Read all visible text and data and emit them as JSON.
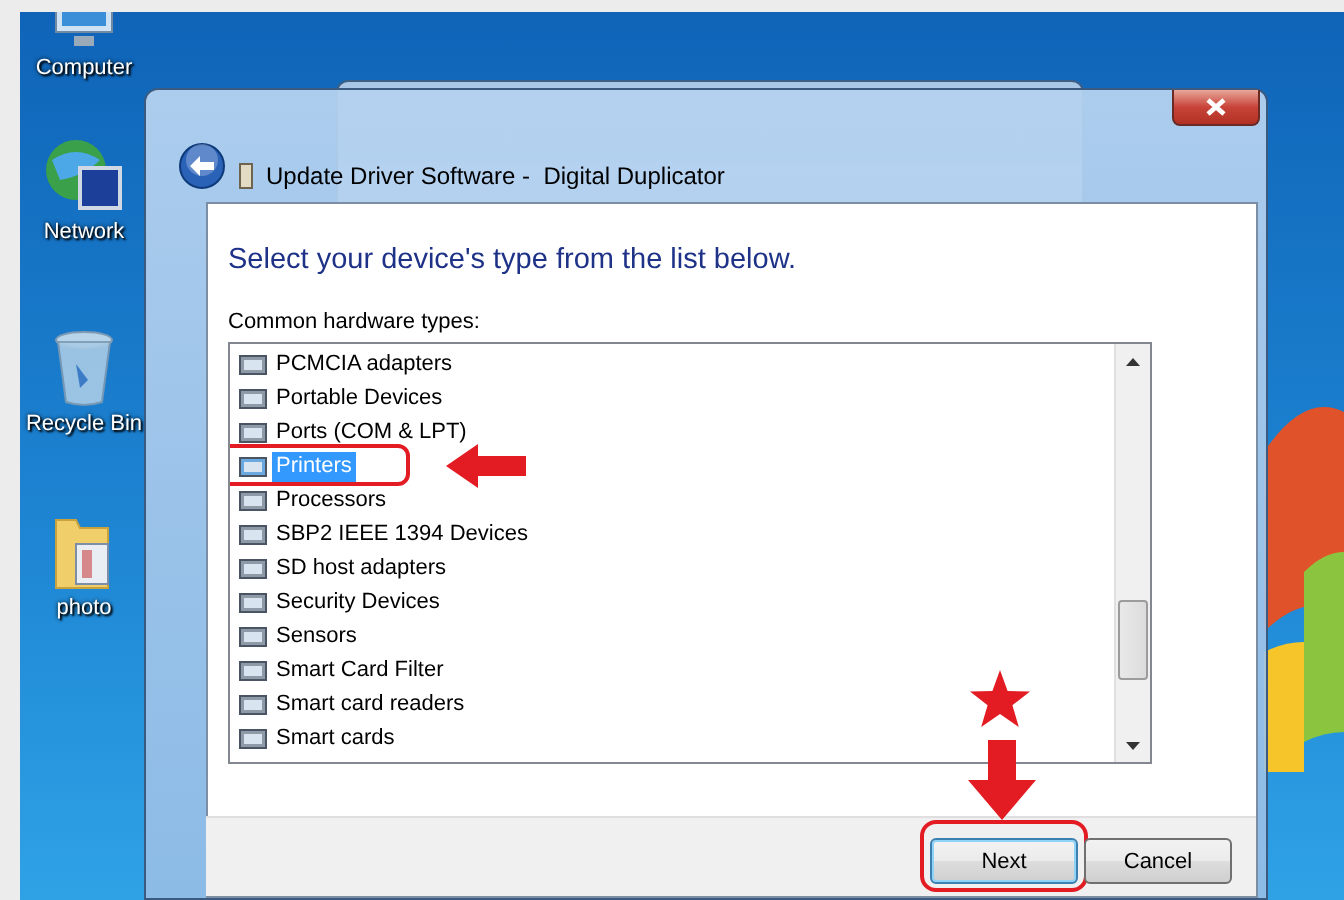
{
  "desktop_icons": [
    {
      "label": "Computer"
    },
    {
      "label": "Network"
    },
    {
      "label": "Recycle Bin"
    },
    {
      "label": "photo"
    }
  ],
  "dialog": {
    "title": "Update Driver Software -  Digital Duplicator",
    "heading": "Select your device's type from the list below.",
    "list_label": "Common hardware types:",
    "device_types": [
      {
        "label": "PCMCIA adapters",
        "selected": false
      },
      {
        "label": "Portable Devices",
        "selected": false
      },
      {
        "label": "Ports (COM & LPT)",
        "selected": false
      },
      {
        "label": "Printers",
        "selected": true
      },
      {
        "label": "Processors",
        "selected": false
      },
      {
        "label": "SBP2 IEEE 1394 Devices",
        "selected": false
      },
      {
        "label": "SD host adapters",
        "selected": false
      },
      {
        "label": "Security Devices",
        "selected": false
      },
      {
        "label": "Sensors",
        "selected": false
      },
      {
        "label": "Smart Card Filter",
        "selected": false
      },
      {
        "label": "Smart card readers",
        "selected": false
      },
      {
        "label": "Smart cards",
        "selected": false
      }
    ],
    "buttons": [
      {
        "label": "Next",
        "focused": true
      },
      {
        "label": "Cancel",
        "focused": false
      }
    ]
  }
}
